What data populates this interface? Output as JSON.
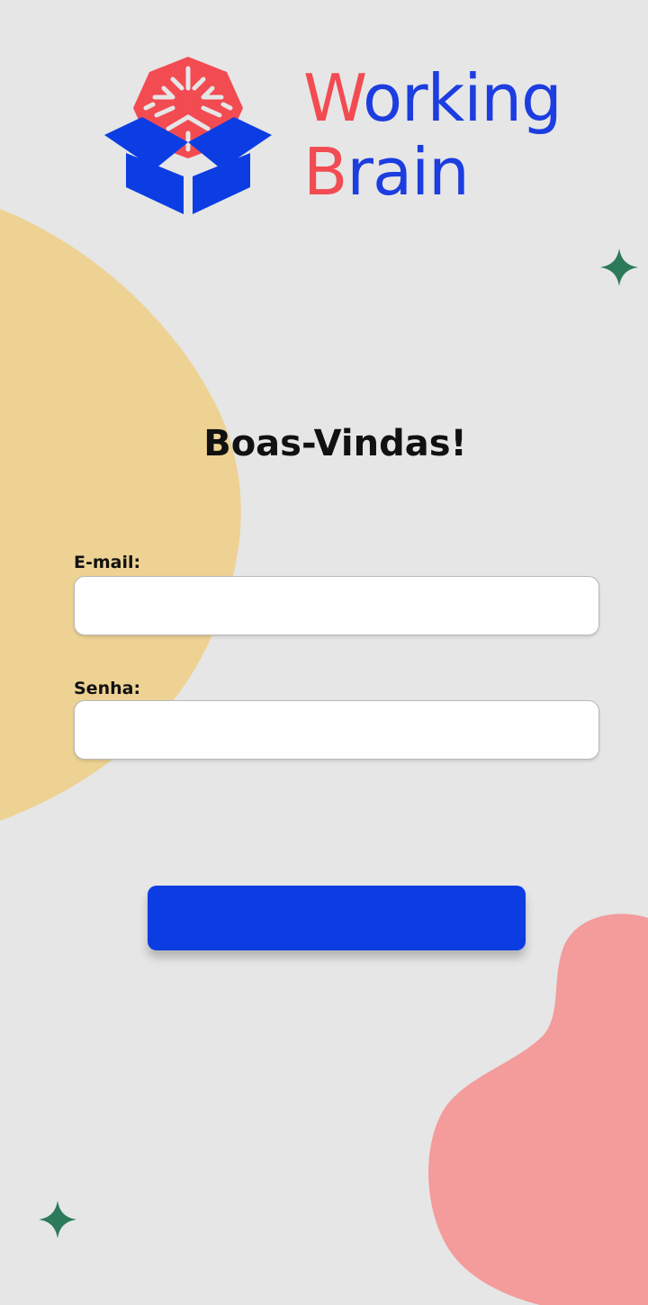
{
  "brand": {
    "line1_initial": "W",
    "line1_rest": "orking",
    "line2_initial": "B",
    "line2_rest": "rain",
    "colors": {
      "red": "#f24b52",
      "blue": "#1c3de0"
    }
  },
  "welcome": {
    "title": "Boas-Vindas!"
  },
  "form": {
    "email": {
      "label": "E-mail:",
      "value": "",
      "placeholder": ""
    },
    "password": {
      "label": "Senha:",
      "value": "",
      "placeholder": ""
    },
    "submit": {
      "label": ""
    }
  },
  "icons": {
    "logo": "brain-in-box-icon",
    "sparkle": "sparkle-icon"
  },
  "colors": {
    "background": "#e6e6e6",
    "yellow_blob": "#edd294",
    "pink_blob": "#f49b9b",
    "sparkle": "#2c7a5a",
    "accent": "#0b3de3"
  }
}
